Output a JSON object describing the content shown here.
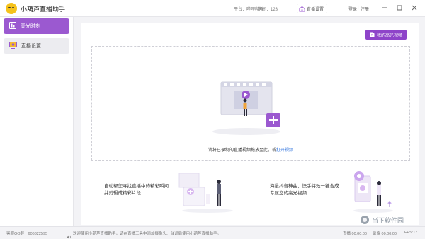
{
  "app": {
    "title": "小葫芦直播助手"
  },
  "titlebar": {
    "platform": "平台：哔哩哔哩",
    "room": "房间：123",
    "live_settings": "直播设置",
    "login": "登录",
    "separator": "|",
    "register": "注册"
  },
  "sidebar": {
    "items": [
      {
        "label": "高光时刻",
        "icon": "highlight-icon",
        "active": true
      },
      {
        "label": "直播设置",
        "icon": "live-monitor-icon",
        "active": false
      }
    ]
  },
  "main": {
    "my_highlights_button": "我的高光视频",
    "drop_zone": {
      "text": "请将已录制的直播视频拖放至此，或",
      "link": "打开视频"
    },
    "features": [
      {
        "line1": "自动帮您寻找直播中的精彩瞬间",
        "line2": "并剪辑成精彩片段"
      },
      {
        "line1": "海量抖音神曲，快手特效一键合成",
        "line2": "专属您的高光视频"
      }
    ]
  },
  "statusbar": {
    "qq_group": "客服QQ群：606322595",
    "notice": "欢迎使用小葫芦直播助手，请在直播工具中添加摄像头、台词后使用小葫芦直播助手。",
    "live_time": "直播 00:00:00",
    "record_time": "录像 00:00:00",
    "fps": "FPS:17"
  },
  "watermark": "当下软件园",
  "colors": {
    "accent": "#9b59d0",
    "link": "#3b7be0"
  }
}
